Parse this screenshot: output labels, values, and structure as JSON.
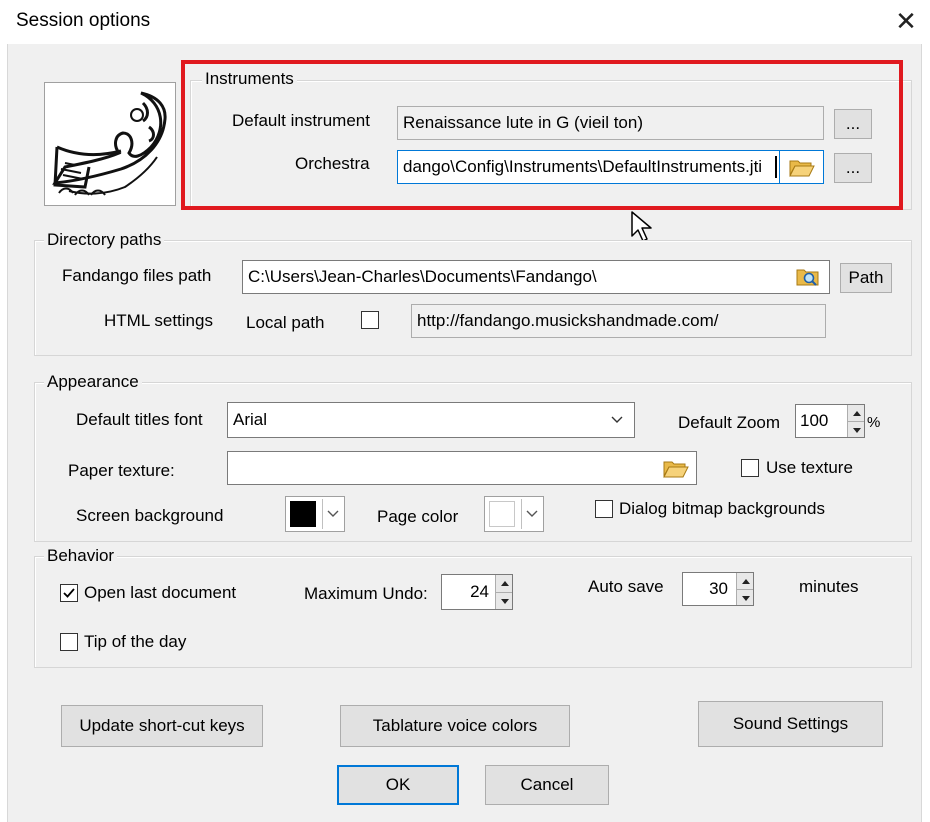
{
  "dialog": {
    "title": "Session options",
    "close_icon": "close-icon"
  },
  "instruments": {
    "group_title": "Instruments",
    "default_instrument_label": "Default instrument",
    "default_instrument_value": "Renaissance lute in G (vieil ton)",
    "orchestra_label": "Orchestra",
    "orchestra_value": "dango\\Config\\Instruments\\DefaultInstruments.jti",
    "browse_label": "...",
    "highlight_color": "#e0191f"
  },
  "directory_paths": {
    "group_title": "Directory paths",
    "files_path_label": "Fandango files path",
    "files_path_value": "C:\\Users\\Jean-Charles\\Documents\\Fandango\\",
    "path_button": "Path",
    "html_settings_label": "HTML settings",
    "local_path_label": "Local path",
    "local_path_checked": false,
    "url_value": "http://fandango.musickshandmade.com/"
  },
  "appearance": {
    "group_title": "Appearance",
    "titles_font_label": "Default titles font",
    "titles_font_value": "Arial",
    "default_zoom_label": "Default Zoom",
    "default_zoom_value": "100",
    "zoom_unit": "%",
    "paper_texture_label": "Paper texture:",
    "paper_texture_value": "",
    "use_texture_label": "Use texture",
    "use_texture_checked": false,
    "screen_background_label": "Screen background",
    "screen_background_color": "#000000",
    "page_color_label": "Page color",
    "page_color": "#ffffff",
    "dialog_bitmap_label": "Dialog bitmap backgrounds",
    "dialog_bitmap_checked": false
  },
  "behavior": {
    "group_title": "Behavior",
    "open_last_label": "Open last document",
    "open_last_checked": true,
    "max_undo_label": "Maximum Undo:",
    "max_undo_value": "24",
    "auto_save_label": "Auto save",
    "auto_save_value": "30",
    "minutes_label": "minutes",
    "tip_label": "Tip of the day",
    "tip_checked": false
  },
  "buttons": {
    "update_shortcuts": "Update short-cut keys",
    "tablature_colors": "Tablature voice colors",
    "sound_settings": "Sound Settings",
    "ok": "OK",
    "cancel": "Cancel"
  }
}
